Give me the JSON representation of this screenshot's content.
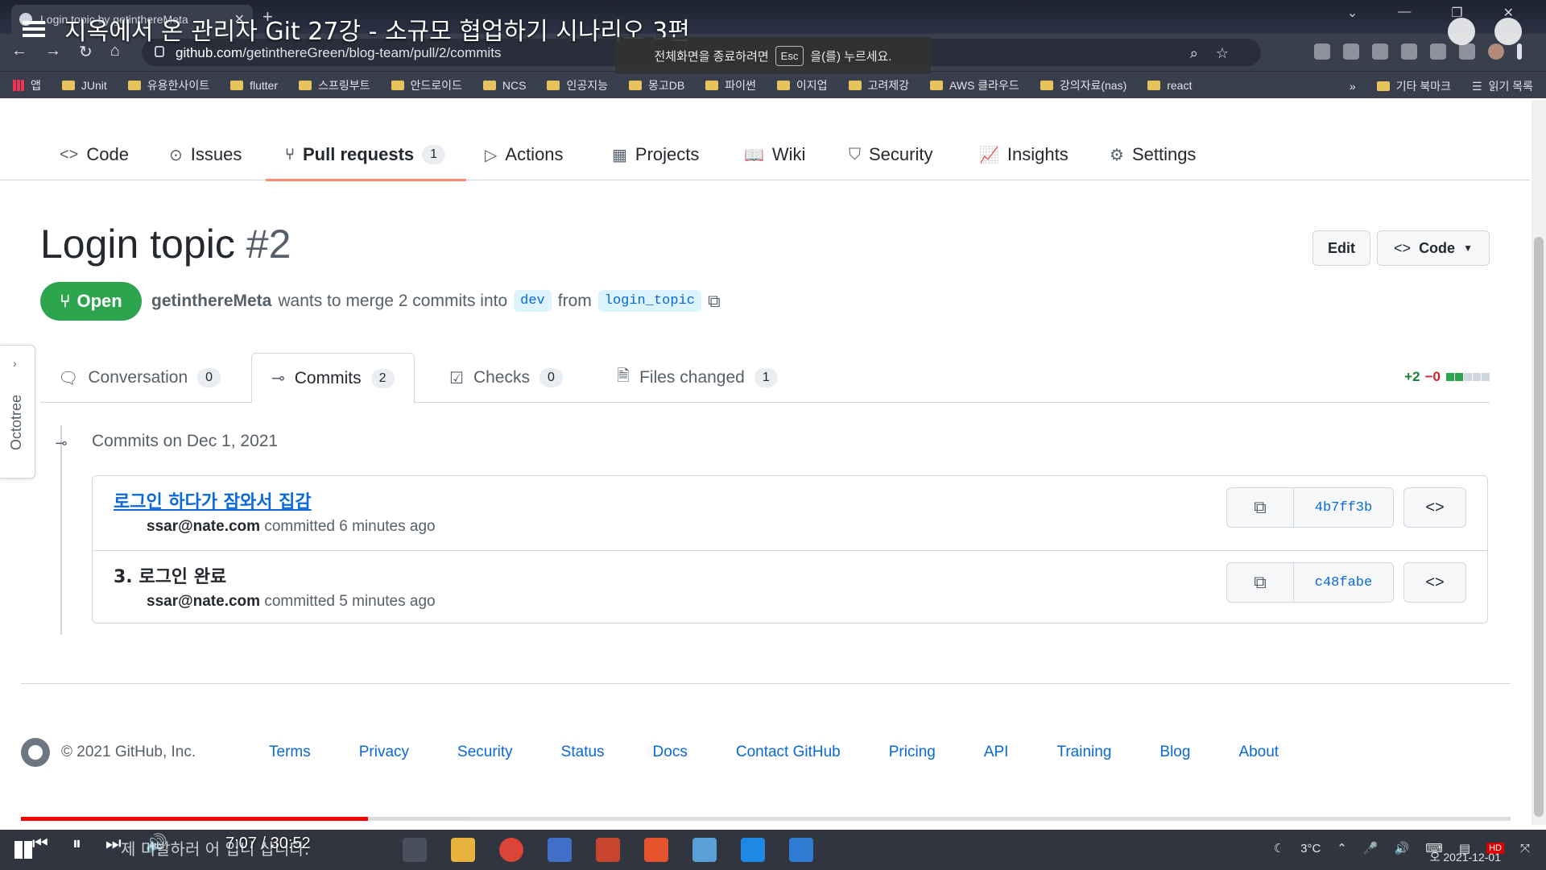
{
  "browser": {
    "tab_title": "Login topic by getinthereMeta",
    "url_host": "github.com",
    "url_path": "/getinthereGreen/blog-team/pull/2/commits",
    "fullscreen_toast_before": "전체화면을 종료하려면",
    "fullscreen_toast_key": "Esc",
    "fullscreen_toast_after": "을(를) 누르세요.",
    "bookmarks": [
      "앱",
      "JUnit",
      "유용한사이트",
      "flutter",
      "스프링부트",
      "안드로이드",
      "NCS",
      "인공지능",
      "몽고DB",
      "파이썬",
      "이지업",
      "고려제강",
      "AWS 클라우드",
      "강의자료(nas)",
      "react"
    ],
    "bookmarks_more": "»",
    "bookmarks_right": [
      "기타 북마크",
      "읽기 목록"
    ]
  },
  "video": {
    "title": "지옥에서 온 관리자 Git 27강 - 소규모 협업하기 시나리오 3편",
    "time": "7:07 / 30:52",
    "progress_played_fraction": 0.233,
    "progress_buffered_fraction": 0.3,
    "caption_overlay": "제 미발하러 어 입니 삽니다."
  },
  "repo_nav": [
    {
      "label": "Code",
      "icon": "code-icon"
    },
    {
      "label": "Issues",
      "icon": "issue-opened-icon"
    },
    {
      "label": "Pull requests",
      "icon": "git-pull-request-icon",
      "count": "1"
    },
    {
      "label": "Actions",
      "icon": "play-icon"
    },
    {
      "label": "Projects",
      "icon": "table-icon"
    },
    {
      "label": "Wiki",
      "icon": "book-icon"
    },
    {
      "label": "Security",
      "icon": "shield-icon"
    },
    {
      "label": "Insights",
      "icon": "graph-icon"
    },
    {
      "label": "Settings",
      "icon": "gear-icon"
    }
  ],
  "pr": {
    "title": "Login topic",
    "number": "#2",
    "edit_label": "Edit",
    "code_label": "Code",
    "state": "Open",
    "author": "getinthereMeta",
    "merge_text": "wants to merge 2 commits into",
    "base_branch": "dev",
    "from_text": "from",
    "head_branch": "login_topic"
  },
  "pr_tabs": [
    {
      "label": "Conversation",
      "count": "0",
      "icon": "comment-discussion-icon"
    },
    {
      "label": "Commits",
      "count": "2",
      "icon": "git-commit-icon"
    },
    {
      "label": "Checks",
      "count": "0",
      "icon": "checklist-icon"
    },
    {
      "label": "Files changed",
      "count": "1",
      "icon": "file-diff-icon"
    }
  ],
  "diffstat": {
    "additions": "+2",
    "deletions": "−0",
    "blocks_green": 2,
    "blocks_gray": 3
  },
  "octotree": {
    "label": "Octotree"
  },
  "commits": {
    "date_heading": "Commits on Dec 1, 2021",
    "items": [
      {
        "message": "로그인 하다가 잠와서 집감",
        "author": "ssar@nate.com",
        "when": "committed 6 minutes ago",
        "sha": "4b7ff3b"
      },
      {
        "message": "3. 로그인 완료",
        "author": "ssar@nate.com",
        "when": "committed 5 minutes ago",
        "sha": "c48fabe"
      }
    ]
  },
  "footer": {
    "copyright": "© 2021 GitHub, Inc.",
    "links": [
      "Terms",
      "Privacy",
      "Security",
      "Status",
      "Docs",
      "Contact GitHub",
      "Pricing",
      "API",
      "Training",
      "Blog",
      "About"
    ]
  },
  "taskbar": {
    "weather": "3°C",
    "date": "2021-12-01",
    "clock_prefix": "오",
    "hd_badge": "HD"
  },
  "colors": {
    "accent_open": "#2da44e",
    "link": "#0969da",
    "tab_underline": "#fd8c73",
    "progress_red": "#ff0000"
  }
}
